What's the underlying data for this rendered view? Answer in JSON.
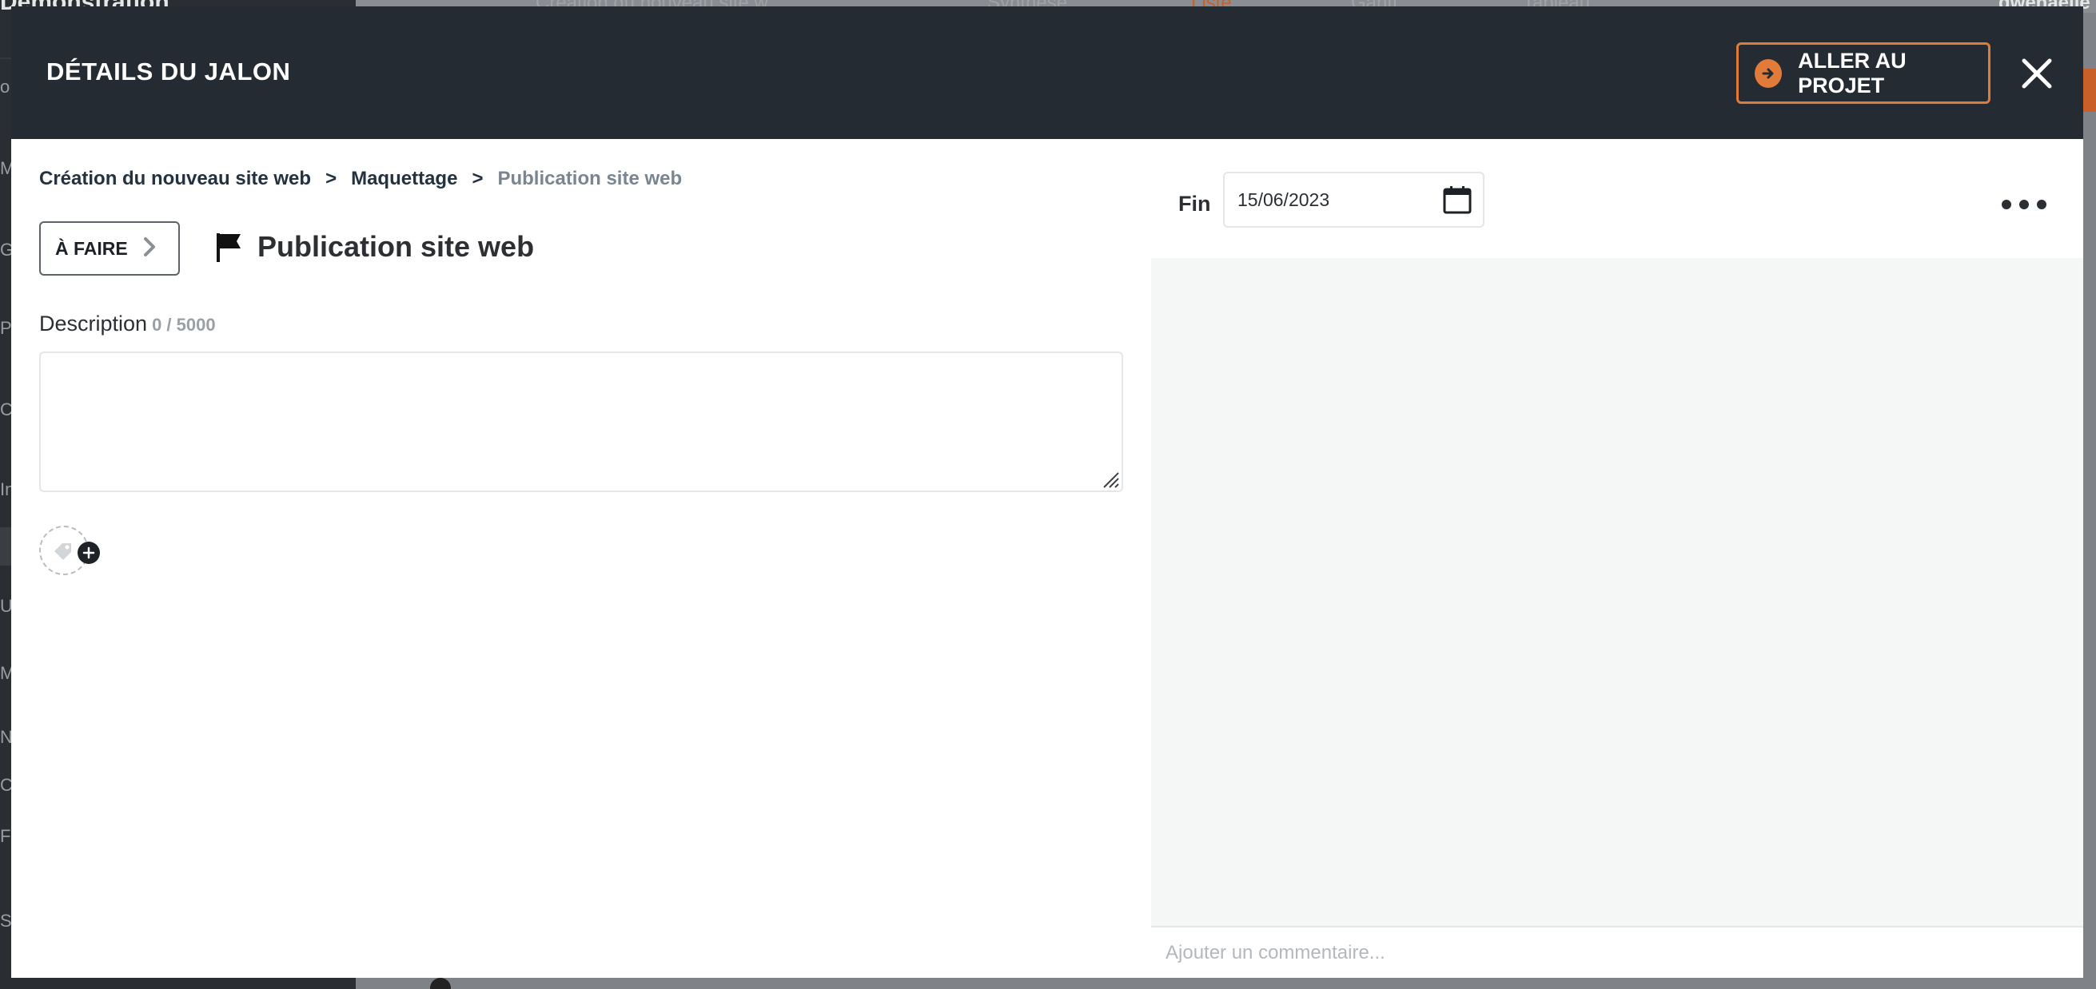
{
  "background": {
    "brand": "Démonstration",
    "project_tab": "Création du nouveau site w...",
    "tabs": [
      "Synthèse",
      "Liste",
      "Gantt",
      "Tableau"
    ],
    "user": "gwenaelle",
    "sidebar_letters": [
      "o",
      "M",
      "G",
      "Po",
      "Ca",
      "In",
      "Ut",
      "M",
      "N",
      "C",
      "F",
      "St"
    ]
  },
  "modal": {
    "title": "DÉTAILS DU JALON",
    "goto_project_label": "ALLER AU PROJET",
    "breadcrumb": [
      "Création du nouveau site web",
      "Maquettage",
      "Publication site web"
    ],
    "breadcrumb_separator": ">",
    "status_label": "À FAIRE",
    "milestone_title": "Publication site web",
    "description_label": "Description",
    "description_count": "0 / 5000",
    "description_value": "",
    "end_label": "Fin",
    "end_date": "15/06/2023",
    "comment_placeholder": "Ajouter un commentaire..."
  },
  "colors": {
    "header": "#252b32",
    "accent": "#e07b39",
    "panel": "#f5f6f6"
  }
}
